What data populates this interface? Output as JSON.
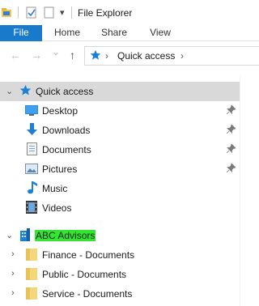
{
  "window": {
    "title": "File Explorer",
    "qat_dropdown": "▾"
  },
  "ribbon": {
    "tabs": [
      {
        "label": "File",
        "active": true
      },
      {
        "label": "Home"
      },
      {
        "label": "Share"
      },
      {
        "label": "View"
      }
    ]
  },
  "address_bar": {
    "back": "←",
    "forward": "→",
    "recent": "⌄",
    "up": "↑",
    "separator": "›",
    "location": "Quick access",
    "trailing_chevron": "›"
  },
  "nav_pane": {
    "quick_access": {
      "label": "Quick access",
      "expander": "⌄",
      "items": [
        {
          "label": "Desktop",
          "icon": "desktop-icon",
          "pinned": true
        },
        {
          "label": "Downloads",
          "icon": "downloads-icon",
          "pinned": true
        },
        {
          "label": "Documents",
          "icon": "documents-icon",
          "pinned": true
        },
        {
          "label": "Pictures",
          "icon": "pictures-icon",
          "pinned": true
        },
        {
          "label": "Music",
          "icon": "music-icon",
          "pinned": false
        },
        {
          "label": "Videos",
          "icon": "videos-icon",
          "pinned": false
        }
      ]
    },
    "org": {
      "label": "ABC Advisors",
      "expander": "⌄",
      "highlight_color": "#31e831",
      "items": [
        {
          "label": "Finance - Documents",
          "expander": "›"
        },
        {
          "label": "Public - Documents",
          "expander": "›"
        },
        {
          "label": "Service - Documents",
          "expander": "›"
        }
      ]
    }
  },
  "colors": {
    "file_tab": "#1979ca",
    "selected_row": "#d9d9d9",
    "folder": "#f4d77a",
    "accent_blue": "#1e7fd6"
  }
}
